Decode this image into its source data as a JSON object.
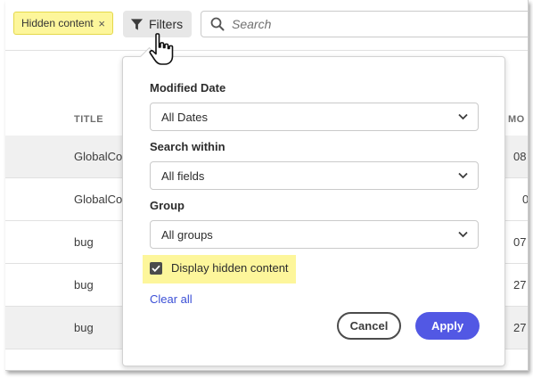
{
  "toolbar": {
    "chip_label": "Hidden content",
    "chip_close": "×",
    "filters_label": "Filters",
    "search_placeholder": "Search"
  },
  "table": {
    "columns": [
      "TITLE",
      "MO"
    ],
    "rows": [
      {
        "title": "GlobalCor",
        "modified": "08"
      },
      {
        "title": "GlobalCo",
        "modified": "0"
      },
      {
        "title": "bug",
        "modified": "07"
      },
      {
        "title": "bug",
        "modified": "27"
      },
      {
        "title": "bug",
        "modified": "27"
      }
    ]
  },
  "filters_panel": {
    "modified_date": {
      "label": "Modified Date",
      "value": "All Dates"
    },
    "search_within": {
      "label": "Search within",
      "value": "All fields"
    },
    "group": {
      "label": "Group",
      "value": "All groups"
    },
    "display_hidden": {
      "label": "Display hidden content",
      "checked": true
    },
    "clear_all": "Clear all",
    "cancel": "Cancel",
    "apply": "Apply"
  },
  "colors": {
    "highlight": "#fdf69b",
    "accent": "#5258e4",
    "link": "#3b4fd6"
  }
}
